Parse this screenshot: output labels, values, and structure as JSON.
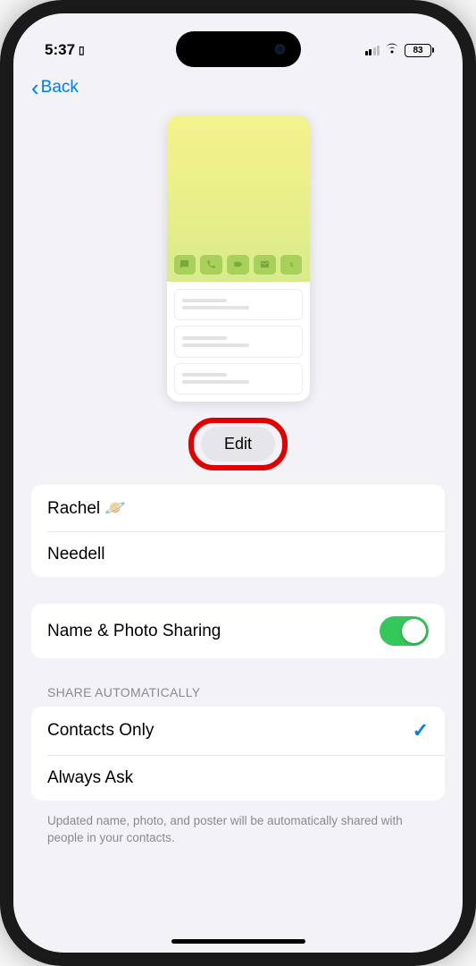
{
  "status": {
    "time": "5:37",
    "battery": "83"
  },
  "nav": {
    "back_label": "Back"
  },
  "edit": {
    "label": "Edit"
  },
  "name": {
    "first": "Rachel 🪐",
    "last": "Needell"
  },
  "sharing": {
    "label": "Name & Photo Sharing",
    "enabled": true
  },
  "share_auto": {
    "header": "SHARE AUTOMATICALLY",
    "options": [
      {
        "label": "Contacts Only",
        "selected": true
      },
      {
        "label": "Always Ask",
        "selected": false
      }
    ],
    "footer": "Updated name, photo, and poster will be automatically shared with people in your contacts."
  }
}
